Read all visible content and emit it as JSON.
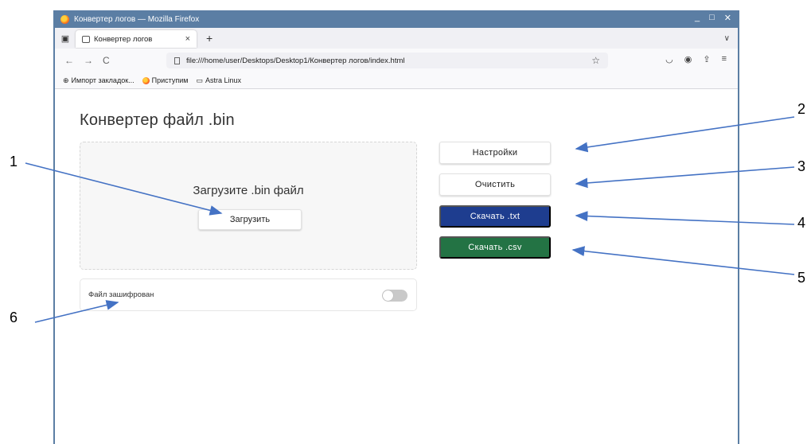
{
  "window": {
    "title": "Конвертер логов — Mozilla Firefox",
    "controls": [
      "_",
      "□",
      "✕"
    ]
  },
  "tabs": [
    {
      "label": "Конвертер логов",
      "close": "×"
    }
  ],
  "tabbar": {
    "new_tab": "+",
    "overflow": "∨"
  },
  "navbar": {
    "back": "←",
    "forward": "→",
    "reload": "C",
    "url": "file:///home/user/Desktops/Desktop1/Конвертер логов/index.html",
    "star": "☆",
    "right_icons": [
      "◡",
      "◉",
      "⇪",
      "≡"
    ]
  },
  "bookmarks": [
    {
      "label": "Импорт закладок...",
      "icon": "import-icon"
    },
    {
      "label": "Приступим",
      "icon": "firefox-icon"
    },
    {
      "label": "Astra Linux",
      "icon": "folder-icon"
    }
  ],
  "page": {
    "title": "Конвертер файл .bin",
    "dropzone": {
      "text": "Загрузите .bin файл",
      "upload_label": "Загрузить"
    },
    "encrypted": {
      "label": "Файл зашифрован",
      "enabled": false
    },
    "buttons": {
      "settings": "Настройки",
      "clear": "Очистить",
      "download_txt": "Скачать .txt",
      "download_csv": "Скачать .csv"
    }
  },
  "colors": {
    "titlebar": "#5b7ea4",
    "download_txt": "#1e3d8f",
    "download_csv": "#237344",
    "arrows": "#4472c4"
  },
  "callouts": [
    "1",
    "2",
    "3",
    "4",
    "5",
    "6"
  ]
}
